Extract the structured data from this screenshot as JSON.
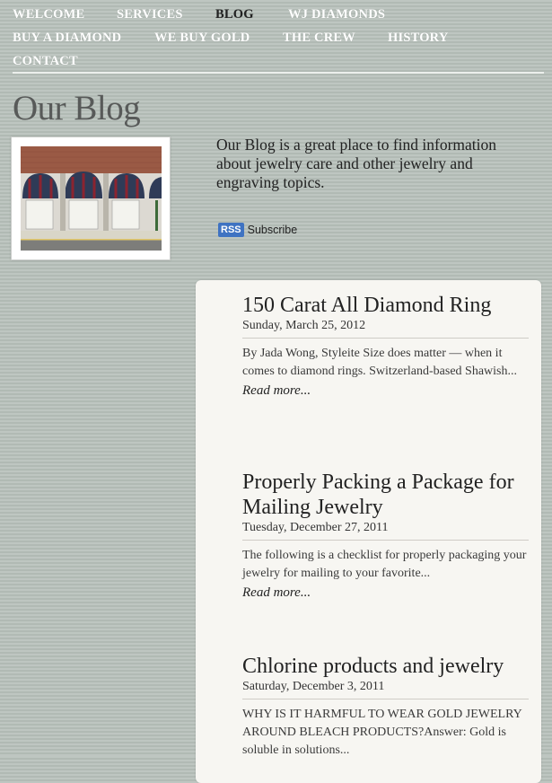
{
  "nav": {
    "items": [
      {
        "label": "WELCOME"
      },
      {
        "label": "SERVICES"
      },
      {
        "label": "BLOG"
      },
      {
        "label": "WJ DIAMONDS"
      },
      {
        "label": "BUY A DIAMOND"
      },
      {
        "label": "WE BUY GOLD"
      },
      {
        "label": "THE CREW"
      },
      {
        "label": "HISTORY"
      },
      {
        "label": "CONTACT"
      }
    ],
    "active": "BLOG"
  },
  "page": {
    "title": "Our Blog",
    "intro": "Our Blog is a great place to find information about jewelry care and other jewelry and engraving topics."
  },
  "rss": {
    "badge": "RSS",
    "label": "Subscribe"
  },
  "posts": [
    {
      "title": "150 Carat All Diamond Ring",
      "date": "Sunday, March 25, 2012",
      "excerpt": "By Jada Wong, Styleite Size does matter — when it comes to diamond rings. Switzerland-based Shawish...",
      "read_more": "Read more..."
    },
    {
      "title": "Properly Packing a Package for Mailing Jewelry",
      "date": "Tuesday, December 27, 2011",
      "excerpt": "The following is a checklist for properly packaging your jewelry for mailing to your favorite...",
      "read_more": "Read more..."
    },
    {
      "title": "Chlorine products and jewelry",
      "date": "Saturday, December 3, 2011",
      "excerpt": "WHY IS IT HARMFUL TO WEAR GOLD JEWELRY AROUND BLEACH PRODUCTS?Answer: Gold is soluble in solutions..."
    }
  ],
  "colors": {
    "background": "#b7c0ba",
    "nav_text": "#ffffff",
    "nav_active": "#222222",
    "panel": "#f7f6f2",
    "title": "#585a59",
    "rss_badge": "#3f73c2"
  }
}
